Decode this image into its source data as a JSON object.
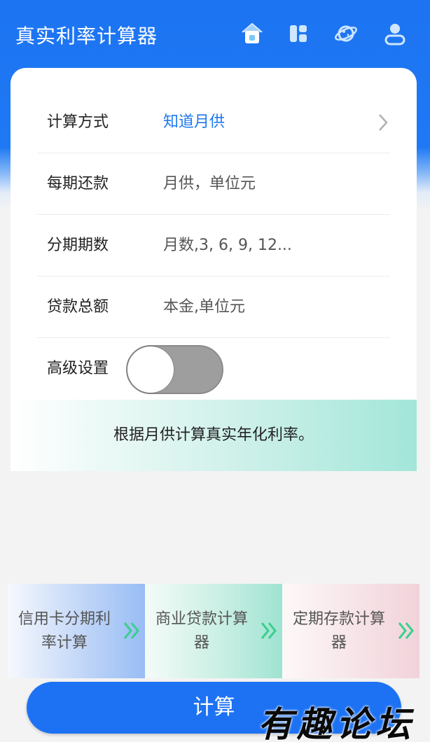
{
  "header": {
    "title": "真实利率计算器",
    "icons": [
      "home-icon",
      "dashboard-icon",
      "planet-icon",
      "user-icon"
    ]
  },
  "form": {
    "method": {
      "label": "计算方式",
      "value": "知道月供"
    },
    "payment": {
      "label": "每期还款",
      "placeholder": "月供，单位元"
    },
    "periods": {
      "label": "分期期数",
      "placeholder": "月数,3, 6, 9, 12..."
    },
    "principal": {
      "label": "贷款总额",
      "placeholder": "本金,单位元"
    },
    "advanced": {
      "label": "高级设置",
      "enabled": false
    }
  },
  "note": "根据月供计算真实年化利率。",
  "shortcuts": [
    {
      "label": "信用卡分期利率计算"
    },
    {
      "label": "商业贷款计算器"
    },
    {
      "label": "定期存款计算器"
    }
  ],
  "calc_button": "计算",
  "watermark": "有趣论坛",
  "colors": {
    "primary": "#1d72f3",
    "accent_text": "#1e78f0",
    "arrow_green": "#3ccf8e"
  }
}
